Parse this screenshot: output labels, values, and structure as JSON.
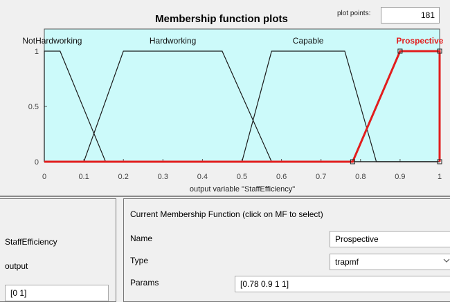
{
  "plot": {
    "title": "Membership function plots",
    "plot_points_label": "plot points:",
    "plot_points_value": "181",
    "xlabel": "output variable \"StaffEfficiency\""
  },
  "chart_data": {
    "type": "line",
    "title": "Membership function plots",
    "xlabel": "output variable \"StaffEfficiency\"",
    "ylabel": "",
    "xlim": [
      0,
      1
    ],
    "ylim": [
      0,
      1
    ],
    "x_ticks": [
      "0",
      "0.1",
      "0.2",
      "0.3",
      "0.4",
      "0.5",
      "0.6",
      "0.7",
      "0.8",
      "0.9",
      "1"
    ],
    "y_ticks": [
      "0",
      "0.5",
      "1"
    ],
    "series": [
      {
        "name": "NotHardworking",
        "params": [
          0,
          0,
          0.04,
          0.155
        ],
        "selected": false
      },
      {
        "name": "Hardworking",
        "params": [
          0.1,
          0.2,
          0.45,
          0.575
        ],
        "selected": false
      },
      {
        "name": "Capable",
        "params": [
          0.5,
          0.575,
          0.76,
          0.84
        ],
        "selected": false
      },
      {
        "name": "Prospective",
        "params": [
          0.78,
          0.9,
          1,
          1
        ],
        "selected": true
      }
    ]
  },
  "left_panel": {
    "var_name": "StaffEfficiency",
    "var_type": "output",
    "range_value": "[0 1]"
  },
  "mf_panel": {
    "header": "Current Membership Function (click on MF to select)",
    "name_label": "Name",
    "name_value": "Prospective",
    "type_label": "Type",
    "type_value": "trapmf",
    "params_label": "Params",
    "params_value": "[0.78 0.9 1 1]"
  },
  "colors": {
    "plot_bg": "#ccfafa",
    "selected": "#e21d1d",
    "line": "#1a1a1a"
  },
  "icons": {
    "dropdown": "chevron-down-icon"
  }
}
